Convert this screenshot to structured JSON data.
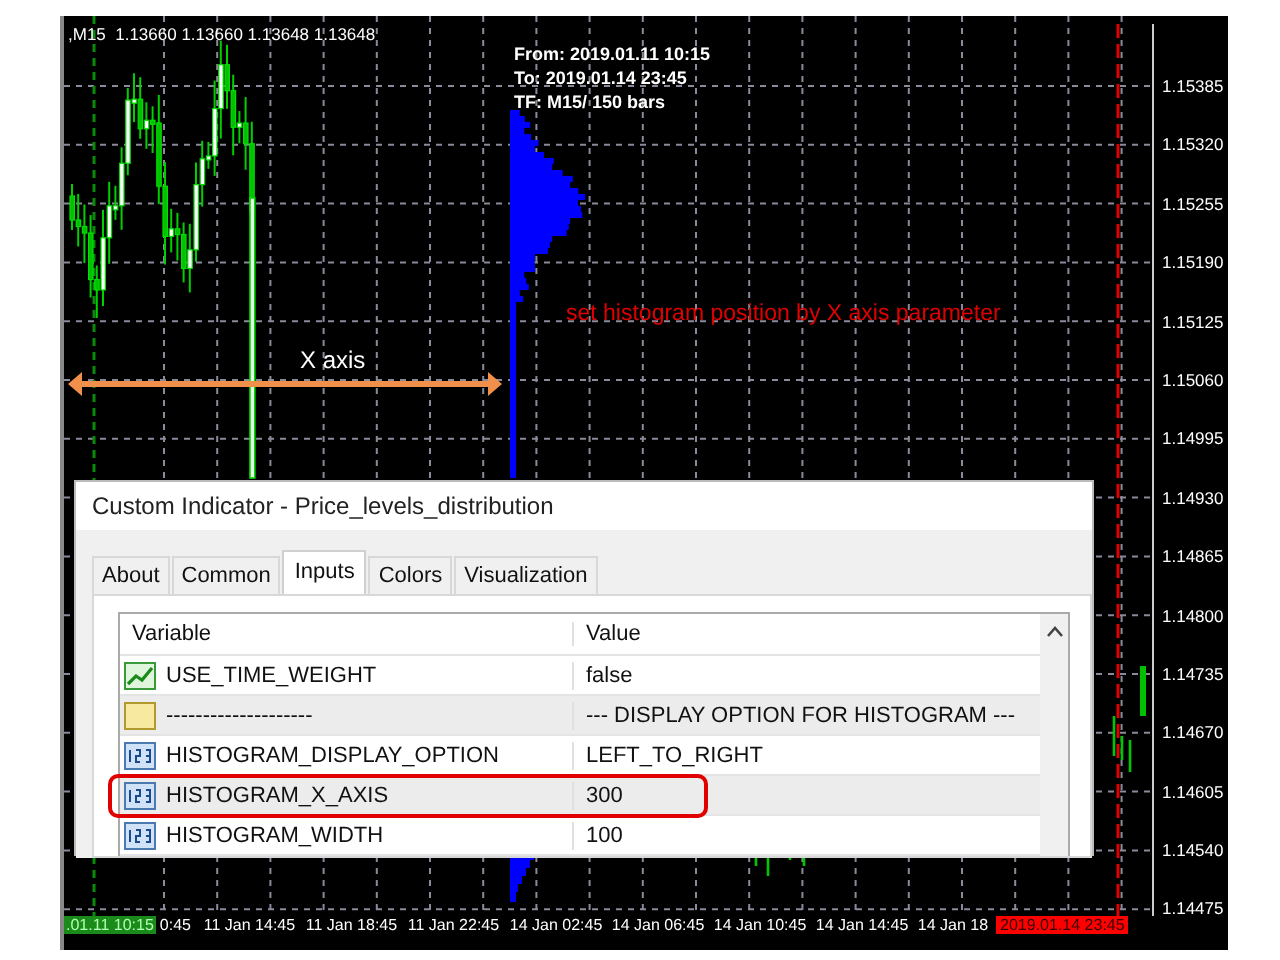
{
  "chart": {
    "header": ",M15  1.13660 1.13660 1.13648 1.13648",
    "info_lines": [
      "From: 2019.01.11 10:15",
      "To: 2019.01.14 23:45",
      "TF: M15/ 150 bars"
    ],
    "annotation": "set histogram position by X axis parameter",
    "arrow_label": "X axis",
    "price_labels": [
      "1.15385",
      "1.15320",
      "1.15255",
      "1.15190",
      "1.15125",
      "1.15060",
      "1.14995",
      "1.14930",
      "1.14865",
      "1.14800",
      "1.14735",
      "1.14670",
      "1.14605",
      "1.14540",
      "1.14475"
    ],
    "time_labels": [
      {
        "text": ".01.11 10:15",
        "kind": "start"
      },
      {
        "text": "0:45",
        "kind": "tick"
      },
      {
        "text": "11 Jan 14:45",
        "kind": "tick"
      },
      {
        "text": "11 Jan 18:45",
        "kind": "tick"
      },
      {
        "text": "11 Jan 22:45",
        "kind": "tick"
      },
      {
        "text": "14 Jan 02:45",
        "kind": "tick"
      },
      {
        "text": "14 Jan 06:45",
        "kind": "tick"
      },
      {
        "text": "14 Jan 10:45",
        "kind": "tick"
      },
      {
        "text": "14 Jan 14:45",
        "kind": "tick"
      },
      {
        "text": "14 Jan 18",
        "kind": "tick"
      },
      {
        "text": "2019.01.14 23:45",
        "kind": "end"
      }
    ]
  },
  "dialog": {
    "title": "Custom Indicator - Price_levels_distribution",
    "tabs": [
      {
        "label": "About",
        "selected": false
      },
      {
        "label": "Common",
        "selected": false
      },
      {
        "label": "Inputs",
        "selected": true
      },
      {
        "label": "Colors",
        "selected": false
      },
      {
        "label": "Visualization",
        "selected": false
      }
    ],
    "columns": [
      "Variable",
      "Value"
    ],
    "rows": [
      {
        "kind": "bool",
        "variable": "USE_TIME_WEIGHT",
        "value": "false",
        "highlighted": false
      },
      {
        "kind": "string",
        "variable": "--------------------",
        "value": "--- DISPLAY OPTION FOR HISTOGRAM ---",
        "highlighted": false
      },
      {
        "kind": "int",
        "variable": "HISTOGRAM_DISPLAY_OPTION",
        "value": "LEFT_TO_RIGHT",
        "highlighted": false
      },
      {
        "kind": "int",
        "variable": "HISTOGRAM_X_AXIS",
        "value": "300",
        "highlighted": true
      },
      {
        "kind": "int",
        "variable": "HISTOGRAM_WIDTH",
        "value": "100",
        "highlighted": false
      }
    ]
  }
}
